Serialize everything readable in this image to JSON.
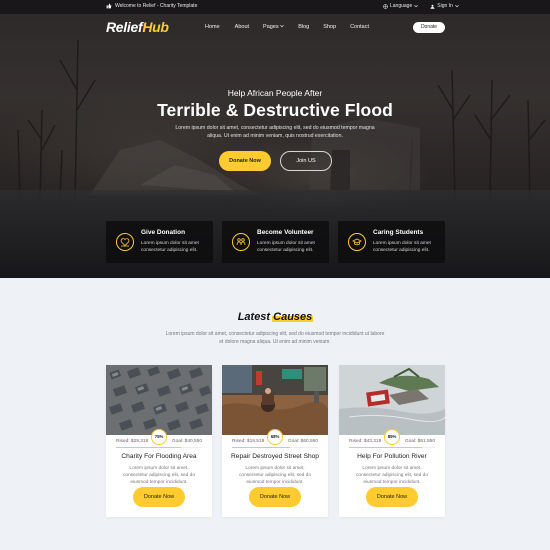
{
  "topbar": {
    "welcome": "Welcome to Relief - Charity Template",
    "language": "Language",
    "signin": "Sign In"
  },
  "brand": {
    "part1": "Relief",
    "part2": "Hub"
  },
  "nav": {
    "items": [
      "Home",
      "About",
      "Pages",
      "Blog",
      "Shop",
      "Contact"
    ],
    "donate": "Donate"
  },
  "hero": {
    "subtitle": "Help African People After",
    "title": "Terrible & Destructive Flood",
    "description": "Lorem ipsum dolor sit amet, consectetur adipiscing elit, sed do eiusmod tempor magna aliqua. Ut enim ad minim veniam, quis nostrud exercitation.",
    "donate_label": "Donate Now",
    "join_label": "Join US"
  },
  "features": [
    {
      "title": "Give Donation",
      "desc": "Lorem ipsum dolor sit amet consectetur adipiscing elit.",
      "icon": "donation-icon"
    },
    {
      "title": "Become Volunteer",
      "desc": "Lorem ipsum dolor sit amet consectetur adipiscing elit.",
      "icon": "volunteer-icon"
    },
    {
      "title": "Caring Students",
      "desc": "Lorem ipsum dolor sit amet consectetur adipiscing elit.",
      "icon": "students-icon"
    }
  ],
  "causes": {
    "title_part1": "Latest",
    "title_part2": "Causes",
    "description": "Lorem ipsum dolor sit amet, consectetur adipiscing elit, sed do eiusmod tempor incididunt ut labore et dolore magna aliqua. Ut enim ad minim veniam.",
    "cards": [
      {
        "raised": "Rised: $29,318",
        "goal": "Goal: $40,550",
        "percent": "75%",
        "progress": 0.75,
        "title": "Charity For Flooding Area",
        "desc": "Lorem ipsum dolor sit amet, consectetur adipiscing elit, sed do eiusmod tempor incididunt.",
        "button": "Donate Now"
      },
      {
        "raised": "Rised: $19,518",
        "goal": "Goal: $60,550",
        "percent": "68%",
        "progress": 0.68,
        "title": "Repair Destroyed Street Shop",
        "desc": "Lorem ipsum dolor sit amet, consectetur adipiscing elit, sed do eiusmod tempor incididunt.",
        "button": "Donate Now"
      },
      {
        "raised": "Rised: $43,318",
        "goal": "Goal: $61,550",
        "percent": "85%",
        "progress": 0.85,
        "title": "Help For Pollution River",
        "desc": "Lorem ipsum dolor sit amet, consectetur adipiscing elit, sed do eiusmod tempor incididunt.",
        "button": "Donate Now"
      }
    ]
  },
  "colors": {
    "accent": "#ffcb2e",
    "dark": "#222222",
    "bg": "#eef1f6"
  }
}
